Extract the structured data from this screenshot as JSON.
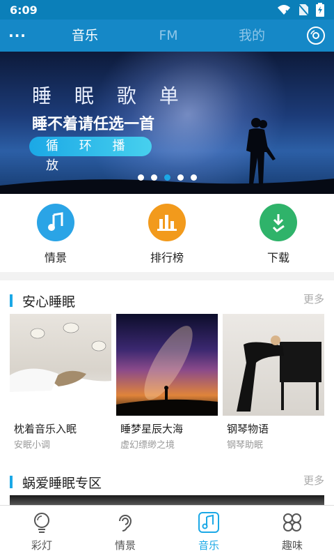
{
  "status_bar": {
    "time": "6:09",
    "icons": [
      "wifi-off-icon",
      "no-sim-icon",
      "battery-charging-icon"
    ]
  },
  "top_nav": {
    "menu_label": "···",
    "tabs": [
      {
        "label": "音乐",
        "active": true
      },
      {
        "label": "FM",
        "active": false
      },
      {
        "label": "我的",
        "active": false
      }
    ],
    "right_icon": "disc-icon"
  },
  "banner": {
    "title": "睡 眠 歌 单",
    "subtitle": "睡不着请任选一首",
    "button_label": "循 环 播 放",
    "dot_count": 5,
    "active_dot": 2
  },
  "quick_entries": [
    {
      "label": "情景",
      "icon": "music-note-icon",
      "color": "#2aa4e6"
    },
    {
      "label": "排行榜",
      "icon": "bar-chart-icon",
      "color": "#f29a1c"
    },
    {
      "label": "下载",
      "icon": "download-check-icon",
      "color": "#2fb36a"
    }
  ],
  "section_sleep": {
    "title": "安心睡眠",
    "more": "更多",
    "cards": [
      {
        "title": "枕着音乐入眠",
        "subtitle": "安眠小调"
      },
      {
        "title": "睡梦星辰大海",
        "subtitle": "虚幻缥缈之境"
      },
      {
        "title": "钢琴物语",
        "subtitle": "钢琴助眠"
      }
    ]
  },
  "section_snail": {
    "title": "蜗爱睡眠专区",
    "more": "更多"
  },
  "bottom_nav": {
    "items": [
      {
        "label": "彩灯",
        "icon": "bulb-icon",
        "active": false
      },
      {
        "label": "情景",
        "icon": "ear-icon",
        "active": false
      },
      {
        "label": "音乐",
        "icon": "music-note-icon",
        "active": true
      },
      {
        "label": "趣味",
        "icon": "grid-flower-icon",
        "active": false
      }
    ]
  },
  "colors": {
    "primary": "#1588c7",
    "status_bar": "#0b7fb9",
    "accent": "#1ba8e6"
  }
}
